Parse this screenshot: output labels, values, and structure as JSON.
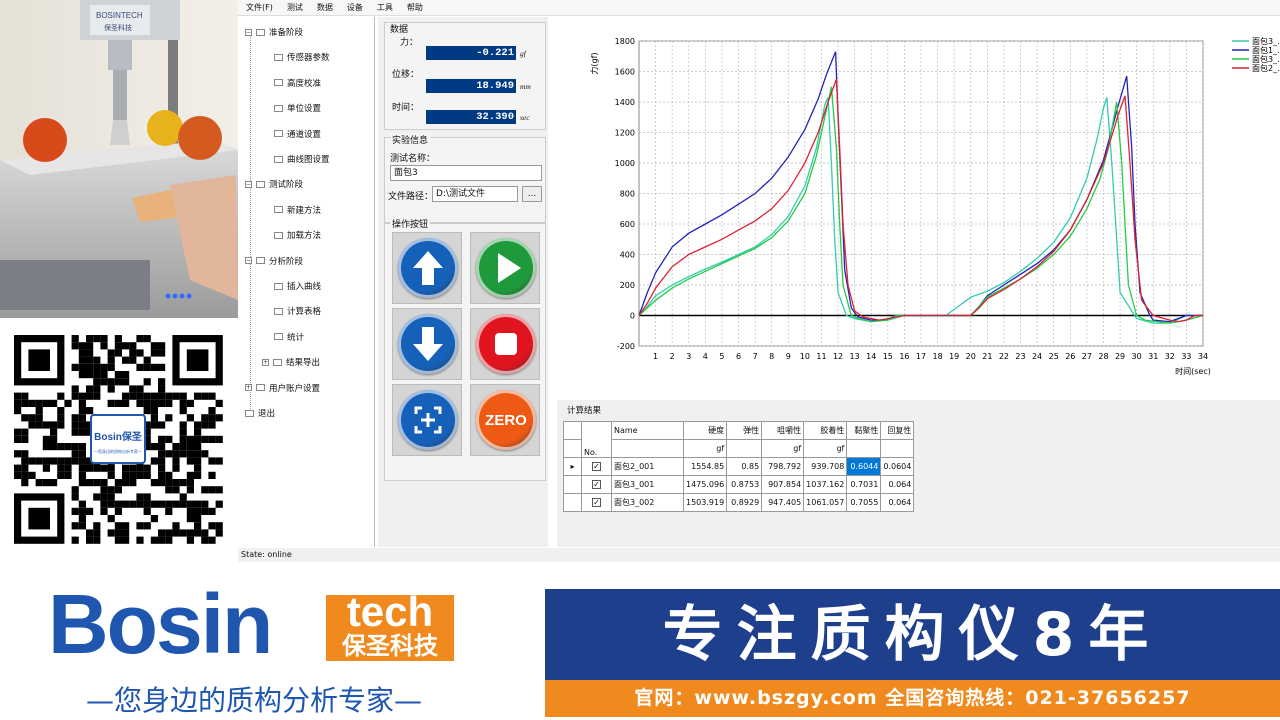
{
  "menu": [
    "文件(F)",
    "测试",
    "数据",
    "设备",
    "工具",
    "帮助"
  ],
  "tree": [
    {
      "label": "准备阶段",
      "level": 0,
      "type": "folder",
      "sign": "−"
    },
    {
      "label": "传感器参数",
      "level": 1,
      "type": "folder"
    },
    {
      "label": "高度校准",
      "level": 1,
      "type": "folder"
    },
    {
      "label": "单位设置",
      "level": 1,
      "type": "folder"
    },
    {
      "label": "通道设置",
      "level": 1,
      "type": "folder"
    },
    {
      "label": "曲线图设置",
      "level": 1,
      "type": "folder"
    },
    {
      "label": "测试阶段",
      "level": 0,
      "type": "folder",
      "sign": "−"
    },
    {
      "label": "新建方法",
      "level": 1,
      "type": "folder"
    },
    {
      "label": "加载方法",
      "level": 1,
      "type": "folder"
    },
    {
      "label": "分析阶段",
      "level": 0,
      "type": "folder",
      "sign": "−"
    },
    {
      "label": "插入曲线",
      "level": 1,
      "type": "folder"
    },
    {
      "label": "计算表格",
      "level": 1,
      "type": "folder"
    },
    {
      "label": "统计",
      "level": 1,
      "type": "folder"
    },
    {
      "label": "结果导出",
      "level": 1,
      "type": "folder",
      "sign": "+"
    },
    {
      "label": "用户账户设置",
      "level": 0,
      "type": "folder",
      "sign": "+"
    },
    {
      "label": "退出",
      "level": 0,
      "type": "folder"
    }
  ],
  "data": {
    "group_title": "数据",
    "force_label": "力：",
    "force_value": "-0.221",
    "force_unit": "gf",
    "disp_label": "位移：",
    "disp_value": "18.949",
    "disp_unit": "mm",
    "time_label": "时间：",
    "time_value": "32.390",
    "time_unit": "sec"
  },
  "experiment": {
    "group_title": "实验信息",
    "name_label": "测试名称：",
    "name_value": "面包3",
    "path_label": "文件路径：",
    "path_value": "D:\\测试文件",
    "browse": "..."
  },
  "ops": {
    "group_title": "操作按钮",
    "zero_label": "ZERO"
  },
  "buttons": [
    {
      "name": "up-button",
      "icon": "arrow-up-icon",
      "color": "#1560b8"
    },
    {
      "name": "start-button",
      "icon": "play-icon",
      "color": "#1e9a3a"
    },
    {
      "name": "down-button",
      "icon": "arrow-down-icon",
      "color": "#1560b8"
    },
    {
      "name": "stop-button",
      "icon": "stop-icon",
      "color": "#e0141e"
    },
    {
      "name": "capture-button",
      "icon": "crosshair-frame-icon",
      "color": "#1560b8"
    },
    {
      "name": "zero-button",
      "icon": "zero-icon",
      "color": "#ee5a14"
    }
  ],
  "results": {
    "title": "计算结果",
    "headers": [
      "No.",
      "Name",
      "硬度",
      "弹性",
      "咀嚼性",
      "胶着性",
      "黏聚性",
      "回复性"
    ],
    "units": [
      "",
      "",
      "gf",
      "",
      "gf",
      "gf",
      "",
      ""
    ],
    "rows": [
      {
        "name": "面包2_001",
        "values": [
          "1554.85",
          "0.85",
          "798.792",
          "939.708",
          "0.6044",
          "0.0604"
        ],
        "selected": true
      },
      {
        "name": "面包3_001",
        "values": [
          "1475.096",
          "0.8753",
          "907.854",
          "1037.162",
          "0.7031",
          "0.064"
        ],
        "selected": false
      },
      {
        "name": "面包3_002",
        "values": [
          "1503.919",
          "0.8929",
          "947.405",
          "1061.057",
          "0.7055",
          "0.064"
        ],
        "selected": false
      }
    ]
  },
  "status": "State:  online",
  "chart_data": {
    "type": "line",
    "ylabel": "力(gf)",
    "xlabel": "时间(sec)",
    "xlim": [
      0,
      34
    ],
    "ylim": [
      -200,
      1800
    ],
    "xticks": [
      1,
      2,
      3,
      4,
      5,
      6,
      7,
      8,
      9,
      10,
      11,
      12,
      13,
      14,
      15,
      16,
      17,
      18,
      19,
      20,
      21,
      22,
      23,
      24,
      25,
      26,
      27,
      28,
      29,
      30,
      31,
      32,
      33,
      34
    ],
    "yticks": [
      -200,
      0,
      200,
      400,
      600,
      800,
      1000,
      1200,
      1400,
      1600,
      1800
    ],
    "grid": true,
    "legend": "top-right",
    "series": [
      {
        "name": "面包3_…",
        "color": "#33ccb0",
        "points": [
          [
            0,
            0
          ],
          [
            0.5,
            60
          ],
          [
            1,
            130
          ],
          [
            2,
            200
          ],
          [
            3,
            255
          ],
          [
            4,
            305
          ],
          [
            5,
            350
          ],
          [
            6,
            400
          ],
          [
            7,
            450
          ],
          [
            8,
            530
          ],
          [
            9,
            650
          ],
          [
            10,
            850
          ],
          [
            10.7,
            1100
          ],
          [
            11.2,
            1380
          ],
          [
            11.4,
            1430
          ],
          [
            11.6,
            1000
          ],
          [
            11.8,
            500
          ],
          [
            12,
            150
          ],
          [
            12.5,
            0
          ],
          [
            13,
            -20
          ],
          [
            14,
            -40
          ],
          [
            15,
            -30
          ],
          [
            16,
            0
          ],
          [
            18.5,
            0
          ],
          [
            19,
            40
          ],
          [
            20,
            120
          ],
          [
            21,
            160
          ],
          [
            22,
            215
          ],
          [
            23,
            290
          ],
          [
            24,
            375
          ],
          [
            25,
            480
          ],
          [
            26,
            640
          ],
          [
            27,
            900
          ],
          [
            27.6,
            1150
          ],
          [
            28,
            1360
          ],
          [
            28.2,
            1430
          ],
          [
            28.5,
            1000
          ],
          [
            28.8,
            500
          ],
          [
            29,
            150
          ],
          [
            30,
            -20
          ],
          [
            31,
            -50
          ],
          [
            32,
            -50
          ],
          [
            33,
            0
          ],
          [
            34,
            0
          ]
        ]
      },
      {
        "name": "面包1_…",
        "color": "#2222bb",
        "points": [
          [
            0,
            0
          ],
          [
            0.5,
            150
          ],
          [
            1,
            280
          ],
          [
            2,
            450
          ],
          [
            3,
            540
          ],
          [
            4,
            600
          ],
          [
            5,
            660
          ],
          [
            6,
            730
          ],
          [
            7,
            800
          ],
          [
            8,
            900
          ],
          [
            9,
            1040
          ],
          [
            10,
            1220
          ],
          [
            10.8,
            1420
          ],
          [
            11.3,
            1580
          ],
          [
            11.85,
            1730
          ],
          [
            12,
            1300
          ],
          [
            12.2,
            800
          ],
          [
            12.4,
            300
          ],
          [
            12.8,
            50
          ],
          [
            13.2,
            -10
          ],
          [
            14,
            -30
          ],
          [
            14.5,
            -30
          ],
          [
            15,
            -25
          ],
          [
            15.5,
            0
          ],
          [
            20,
            0
          ],
          [
            20.5,
            60
          ],
          [
            21,
            130
          ],
          [
            22,
            200
          ],
          [
            23,
            270
          ],
          [
            24,
            340
          ],
          [
            25,
            430
          ],
          [
            26,
            560
          ],
          [
            27,
            760
          ],
          [
            28,
            1020
          ],
          [
            28.9,
            1380
          ],
          [
            29.4,
            1570
          ],
          [
            29.7,
            1100
          ],
          [
            29.9,
            600
          ],
          [
            30.2,
            150
          ],
          [
            30.8,
            0
          ],
          [
            31,
            -30
          ],
          [
            32,
            -40
          ],
          [
            33,
            0
          ],
          [
            34,
            0
          ]
        ]
      },
      {
        "name": "面包3_…",
        "color": "#22cc44",
        "points": [
          [
            0,
            0
          ],
          [
            0.5,
            50
          ],
          [
            1,
            100
          ],
          [
            2,
            180
          ],
          [
            3,
            240
          ],
          [
            4,
            290
          ],
          [
            5,
            340
          ],
          [
            6,
            390
          ],
          [
            7,
            440
          ],
          [
            8,
            510
          ],
          [
            9,
            620
          ],
          [
            10,
            800
          ],
          [
            10.7,
            1050
          ],
          [
            11.2,
            1300
          ],
          [
            11.6,
            1500
          ],
          [
            11.9,
            1100
          ],
          [
            12.1,
            600
          ],
          [
            12.3,
            200
          ],
          [
            12.8,
            0
          ],
          [
            13.2,
            -20
          ],
          [
            14,
            -40
          ],
          [
            15,
            -30
          ],
          [
            15.5,
            0
          ],
          [
            20,
            0
          ],
          [
            20.5,
            60
          ],
          [
            21,
            120
          ],
          [
            22,
            180
          ],
          [
            23,
            240
          ],
          [
            24,
            310
          ],
          [
            25,
            400
          ],
          [
            26,
            520
          ],
          [
            27,
            700
          ],
          [
            27.8,
            900
          ],
          [
            28.3,
            1100
          ],
          [
            28.8,
            1400
          ],
          [
            29.1,
            1000
          ],
          [
            29.3,
            600
          ],
          [
            29.5,
            200
          ],
          [
            30,
            0
          ],
          [
            30.5,
            -30
          ],
          [
            32,
            -50
          ],
          [
            33,
            -30
          ],
          [
            34,
            0
          ]
        ]
      },
      {
        "name": "面包2_…",
        "color": "#dd2233",
        "points": [
          [
            0,
            0
          ],
          [
            0.5,
            80
          ],
          [
            1,
            180
          ],
          [
            2,
            320
          ],
          [
            3,
            400
          ],
          [
            4,
            450
          ],
          [
            5,
            500
          ],
          [
            6,
            560
          ],
          [
            7,
            620
          ],
          [
            8,
            700
          ],
          [
            9,
            820
          ],
          [
            10,
            1000
          ],
          [
            10.8,
            1200
          ],
          [
            11.4,
            1400
          ],
          [
            11.9,
            1550
          ],
          [
            12.1,
            1100
          ],
          [
            12.3,
            600
          ],
          [
            12.6,
            200
          ],
          [
            13,
            30
          ],
          [
            13.5,
            -10
          ],
          [
            14.5,
            -30
          ],
          [
            15,
            -20
          ],
          [
            16,
            0
          ],
          [
            20,
            0
          ],
          [
            20.5,
            50
          ],
          [
            21,
            110
          ],
          [
            22,
            170
          ],
          [
            23,
            240
          ],
          [
            24,
            320
          ],
          [
            25,
            420
          ],
          [
            26,
            560
          ],
          [
            27,
            760
          ],
          [
            28,
            1000
          ],
          [
            28.9,
            1320
          ],
          [
            29.3,
            1440
          ],
          [
            29.6,
            1000
          ],
          [
            29.9,
            500
          ],
          [
            30.3,
            100
          ],
          [
            31,
            0
          ],
          [
            32,
            -30
          ],
          [
            32.5,
            -40
          ],
          [
            33,
            -30
          ],
          [
            33.5,
            0
          ],
          [
            34,
            0
          ]
        ]
      }
    ]
  },
  "banner": {
    "logo": "Bosin",
    "tech": "tech",
    "brand_cn": "保圣科技",
    "tagline": "—您身边的质构分析专家—",
    "slogan": "专注质构仪8年",
    "site": "官网：www.bszgy.com  全国咨询热线：021-37656257",
    "qr_logo": "Bosin保圣",
    "qr_sub": "—您身边的质构分析专家—",
    "camera_brand": "BOSINTECH",
    "camera_brand_cn": "保圣科技"
  },
  "colors": {
    "navy": "#1d3f8c",
    "orange": "#f08a1e",
    "readout": "#003a82",
    "brand_blue": "#1f57b0"
  }
}
